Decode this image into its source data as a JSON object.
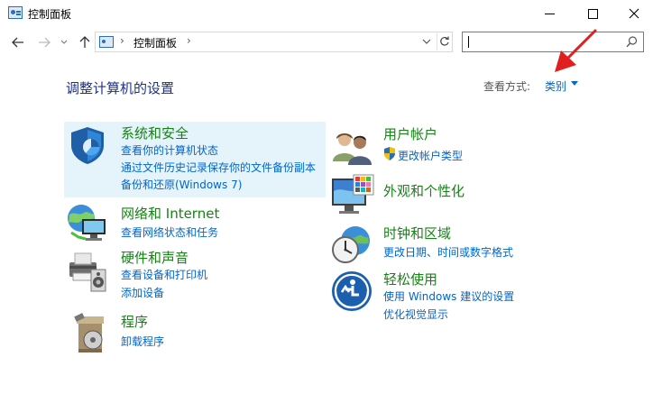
{
  "window": {
    "title": "控制面板"
  },
  "address": {
    "path": "控制面板"
  },
  "search": {
    "placeholder": ""
  },
  "header": {
    "heading": "调整计算机的设置",
    "view_by_label": "查看方式:",
    "view_by_value": "类别"
  },
  "categories": [
    {
      "title": "系统和安全",
      "links": [
        "查看你的计算机状态",
        "通过文件历史记录保存你的文件备份副本",
        "备份和还原(Windows 7)"
      ],
      "icon": "shield-icon"
    },
    {
      "title": "网络和 Internet",
      "links": [
        "查看网络状态和任务"
      ],
      "icon": "network-globe-icon"
    },
    {
      "title": "硬件和声音",
      "links": [
        "查看设备和打印机",
        "添加设备"
      ],
      "icon": "printer-icon"
    },
    {
      "title": "程序",
      "links": [
        "卸载程序"
      ],
      "icon": "programs-icon"
    },
    {
      "title": "用户帐户",
      "links": [
        "更改帐户类型"
      ],
      "icon": "users-icon"
    },
    {
      "title": "外观和个性化",
      "links": [],
      "icon": "monitor-palette-icon"
    },
    {
      "title": "时钟和区域",
      "links": [
        "更改日期、时间或数字格式"
      ],
      "icon": "clock-globe-icon"
    },
    {
      "title": "轻松使用",
      "links": [
        "使用 Windows 建议的设置",
        "优化视觉显示"
      ],
      "icon": "accessibility-icon"
    }
  ],
  "colors": {
    "category_title": "#178317",
    "link": "#0066cc",
    "heading": "#1e3287",
    "highlight": "#e5f3fb",
    "annotation_arrow": "#e02020"
  }
}
